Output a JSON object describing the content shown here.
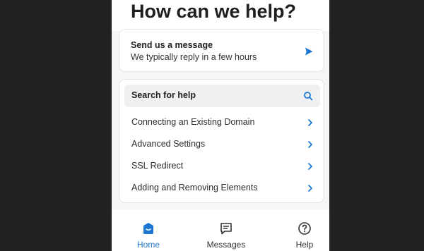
{
  "header": {
    "title": "How can we help?"
  },
  "message_card": {
    "title": "Send us a message",
    "subtitle": "We typically reply in a few hours",
    "icon": "send-icon"
  },
  "help": {
    "search_label": "Search for help",
    "items": [
      {
        "label": "Connecting an Existing Domain"
      },
      {
        "label": "Advanced Settings"
      },
      {
        "label": "SSL Redirect"
      },
      {
        "label": "Adding and Removing Elements"
      }
    ]
  },
  "nav": {
    "tabs": [
      {
        "label": "Home",
        "icon": "home-icon",
        "active": true
      },
      {
        "label": "Messages",
        "icon": "messages-icon",
        "active": false
      },
      {
        "label": "Help",
        "icon": "help-icon",
        "active": false
      }
    ]
  },
  "colors": {
    "accent": "#1d76d2",
    "page_background": "#222222",
    "panel_background": "#f5f6f7"
  }
}
